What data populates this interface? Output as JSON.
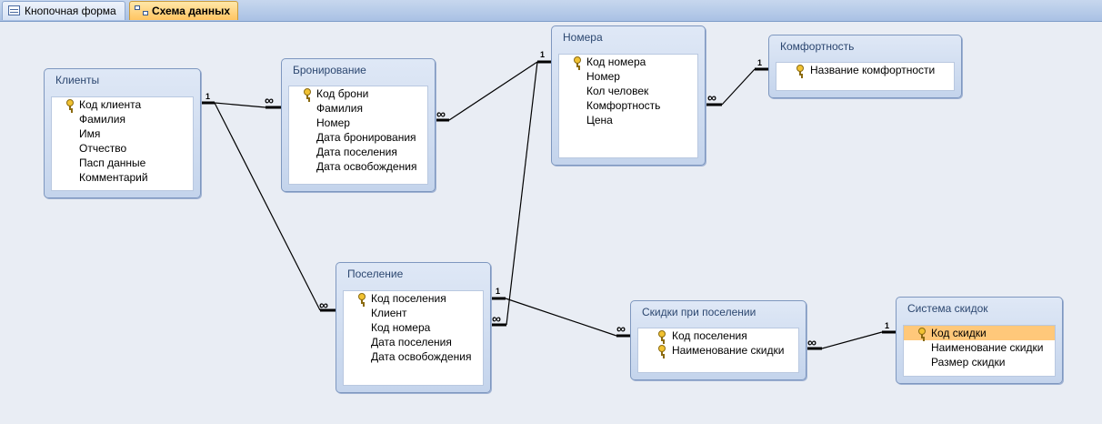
{
  "tabs": [
    {
      "label": "Кнопочная форма",
      "icon": "form-icon",
      "active": false
    },
    {
      "label": "Схема данных",
      "icon": "schema-icon",
      "active": true
    }
  ],
  "tables": {
    "klienty": {
      "title": "Клиенты",
      "fields": [
        "Код клиента",
        "Фамилия",
        "Имя",
        "Отчество",
        "Пасп данные",
        "Комментарий"
      ],
      "key_field": "Код клиента"
    },
    "bronirovanie": {
      "title": "Бронирование",
      "fields": [
        "Код брони",
        "Фамилия",
        "Номер",
        "Дата бронирования",
        "Дата поселения",
        "Дата освобождения"
      ],
      "key_field": "Код брони"
    },
    "nomera": {
      "title": "Номера",
      "fields": [
        "Код номера",
        "Номер",
        "Кол человек",
        "Комфортность",
        "Цена"
      ],
      "key_field": "Код номера"
    },
    "komfortnost": {
      "title": "Комфортность",
      "fields": [
        "Название комфортности"
      ],
      "key_field": "Название комфортности"
    },
    "poselenie": {
      "title": "Поселение",
      "fields": [
        "Код поселения",
        "Клиент",
        "Код номера",
        "Дата поселения",
        "Дата освобождения"
      ],
      "key_field": "Код поселения"
    },
    "skidki": {
      "title": "Скидки при поселении",
      "fields": [
        "Код поселения",
        "Наименование скидки"
      ],
      "key_fields": [
        "Код поселения",
        "Наименование скидки"
      ]
    },
    "sistema": {
      "title": "Система скидок",
      "fields": [
        "Код скидки",
        "Наименование скидки",
        "Размер скидки"
      ],
      "key_field": "Код скидки",
      "selected_field": "Код скидки"
    }
  },
  "cardinality": {
    "one": "1",
    "many": "∞"
  },
  "colors": {
    "selected_field": "#ffc87a",
    "active_tab": "#ffc562",
    "title_text": "#2c4770"
  }
}
